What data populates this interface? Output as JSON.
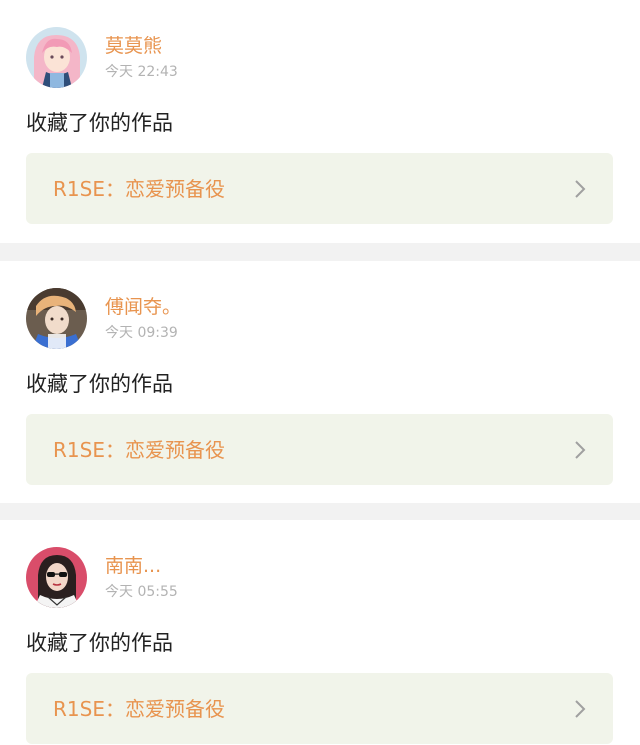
{
  "notifications": [
    {
      "username": "莫莫熊",
      "time": "今天 22:43",
      "action": "收藏了你的作品",
      "work_title": "R1SE：恋爱预备役",
      "avatar_icon": "anime-girl-avatar"
    },
    {
      "username": "傅闻夺。",
      "time": "今天 09:39",
      "action": "收藏了你的作品",
      "work_title": "R1SE：恋爱预备役",
      "avatar_icon": "anime-character-avatar"
    },
    {
      "username": "南南...",
      "time": "今天 05:55",
      "action": "收藏了你的作品",
      "work_title": "R1SE：恋爱预备役",
      "avatar_icon": "girl-sunglasses-avatar"
    }
  ],
  "colors": {
    "accent": "#e8944f",
    "timestamp": "#b3b3b3",
    "link_bg": "#f1f4ea",
    "separator": "#f2f2f2"
  }
}
